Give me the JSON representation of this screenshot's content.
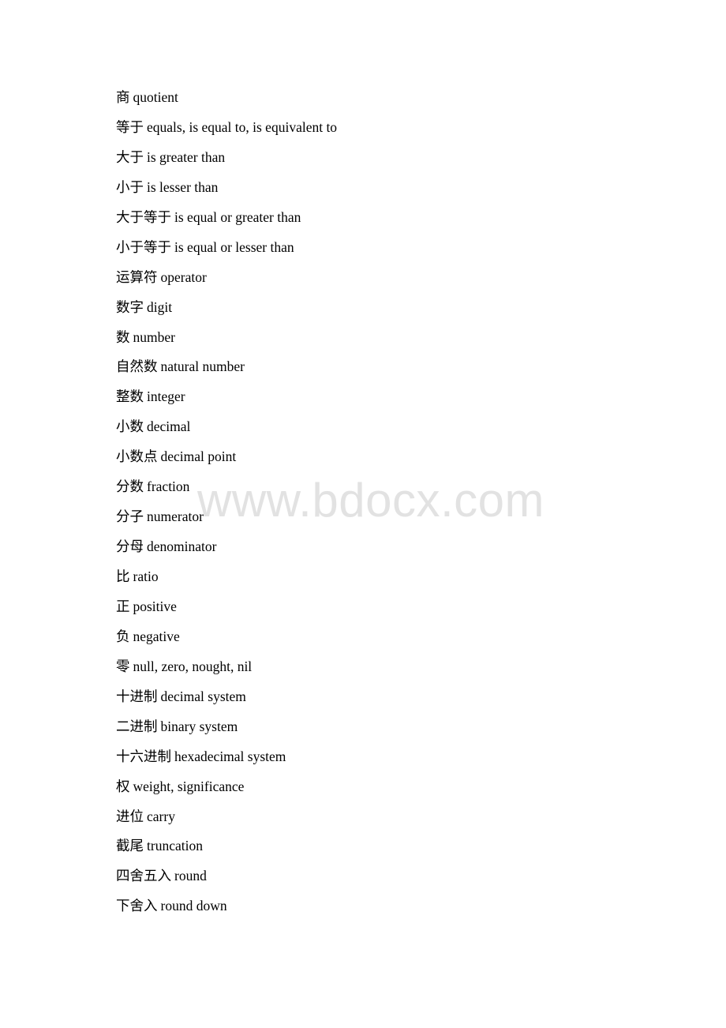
{
  "watermark": {
    "text": "www.bdocx.com",
    "color": "#e2e2e2"
  },
  "entries": [
    {
      "zh": "商",
      "en": "quotient"
    },
    {
      "zh": "等于",
      "en": "equals, is equal to, is equivalent to"
    },
    {
      "zh": "大于",
      "en": "is greater than"
    },
    {
      "zh": "小于",
      "en": "is lesser than"
    },
    {
      "zh": "大于等于",
      "en": "is equal or greater than"
    },
    {
      "zh": "小于等于",
      "en": "is equal or lesser than"
    },
    {
      "zh": "运算符",
      "en": "operator"
    },
    {
      "zh": "数字",
      "en": "digit"
    },
    {
      "zh": "数",
      "en": "number"
    },
    {
      "zh": "自然数",
      "en": "natural number"
    },
    {
      "zh": "整数",
      "en": "integer"
    },
    {
      "zh": "小数",
      "en": "decimal"
    },
    {
      "zh": "小数点",
      "en": "decimal point"
    },
    {
      "zh": "分数",
      "en": "fraction"
    },
    {
      "zh": "分子",
      "en": "numerator"
    },
    {
      "zh": "分母",
      "en": "denominator"
    },
    {
      "zh": "比",
      "en": "ratio"
    },
    {
      "zh": "正",
      "en": "positive"
    },
    {
      "zh": "负",
      "en": "negative"
    },
    {
      "zh": "零",
      "en": "null, zero, nought, nil"
    },
    {
      "zh": "十进制",
      "en": "decimal system"
    },
    {
      "zh": "二进制",
      "en": "binary system"
    },
    {
      "zh": "十六进制",
      "en": "hexadecimal system"
    },
    {
      "zh": "权",
      "en": "weight, significance"
    },
    {
      "zh": "进位",
      "en": "carry"
    },
    {
      "zh": "截尾",
      "en": "truncation"
    },
    {
      "zh": "四舍五入",
      "en": "round"
    },
    {
      "zh": "下舍入",
      "en": "round down"
    }
  ]
}
